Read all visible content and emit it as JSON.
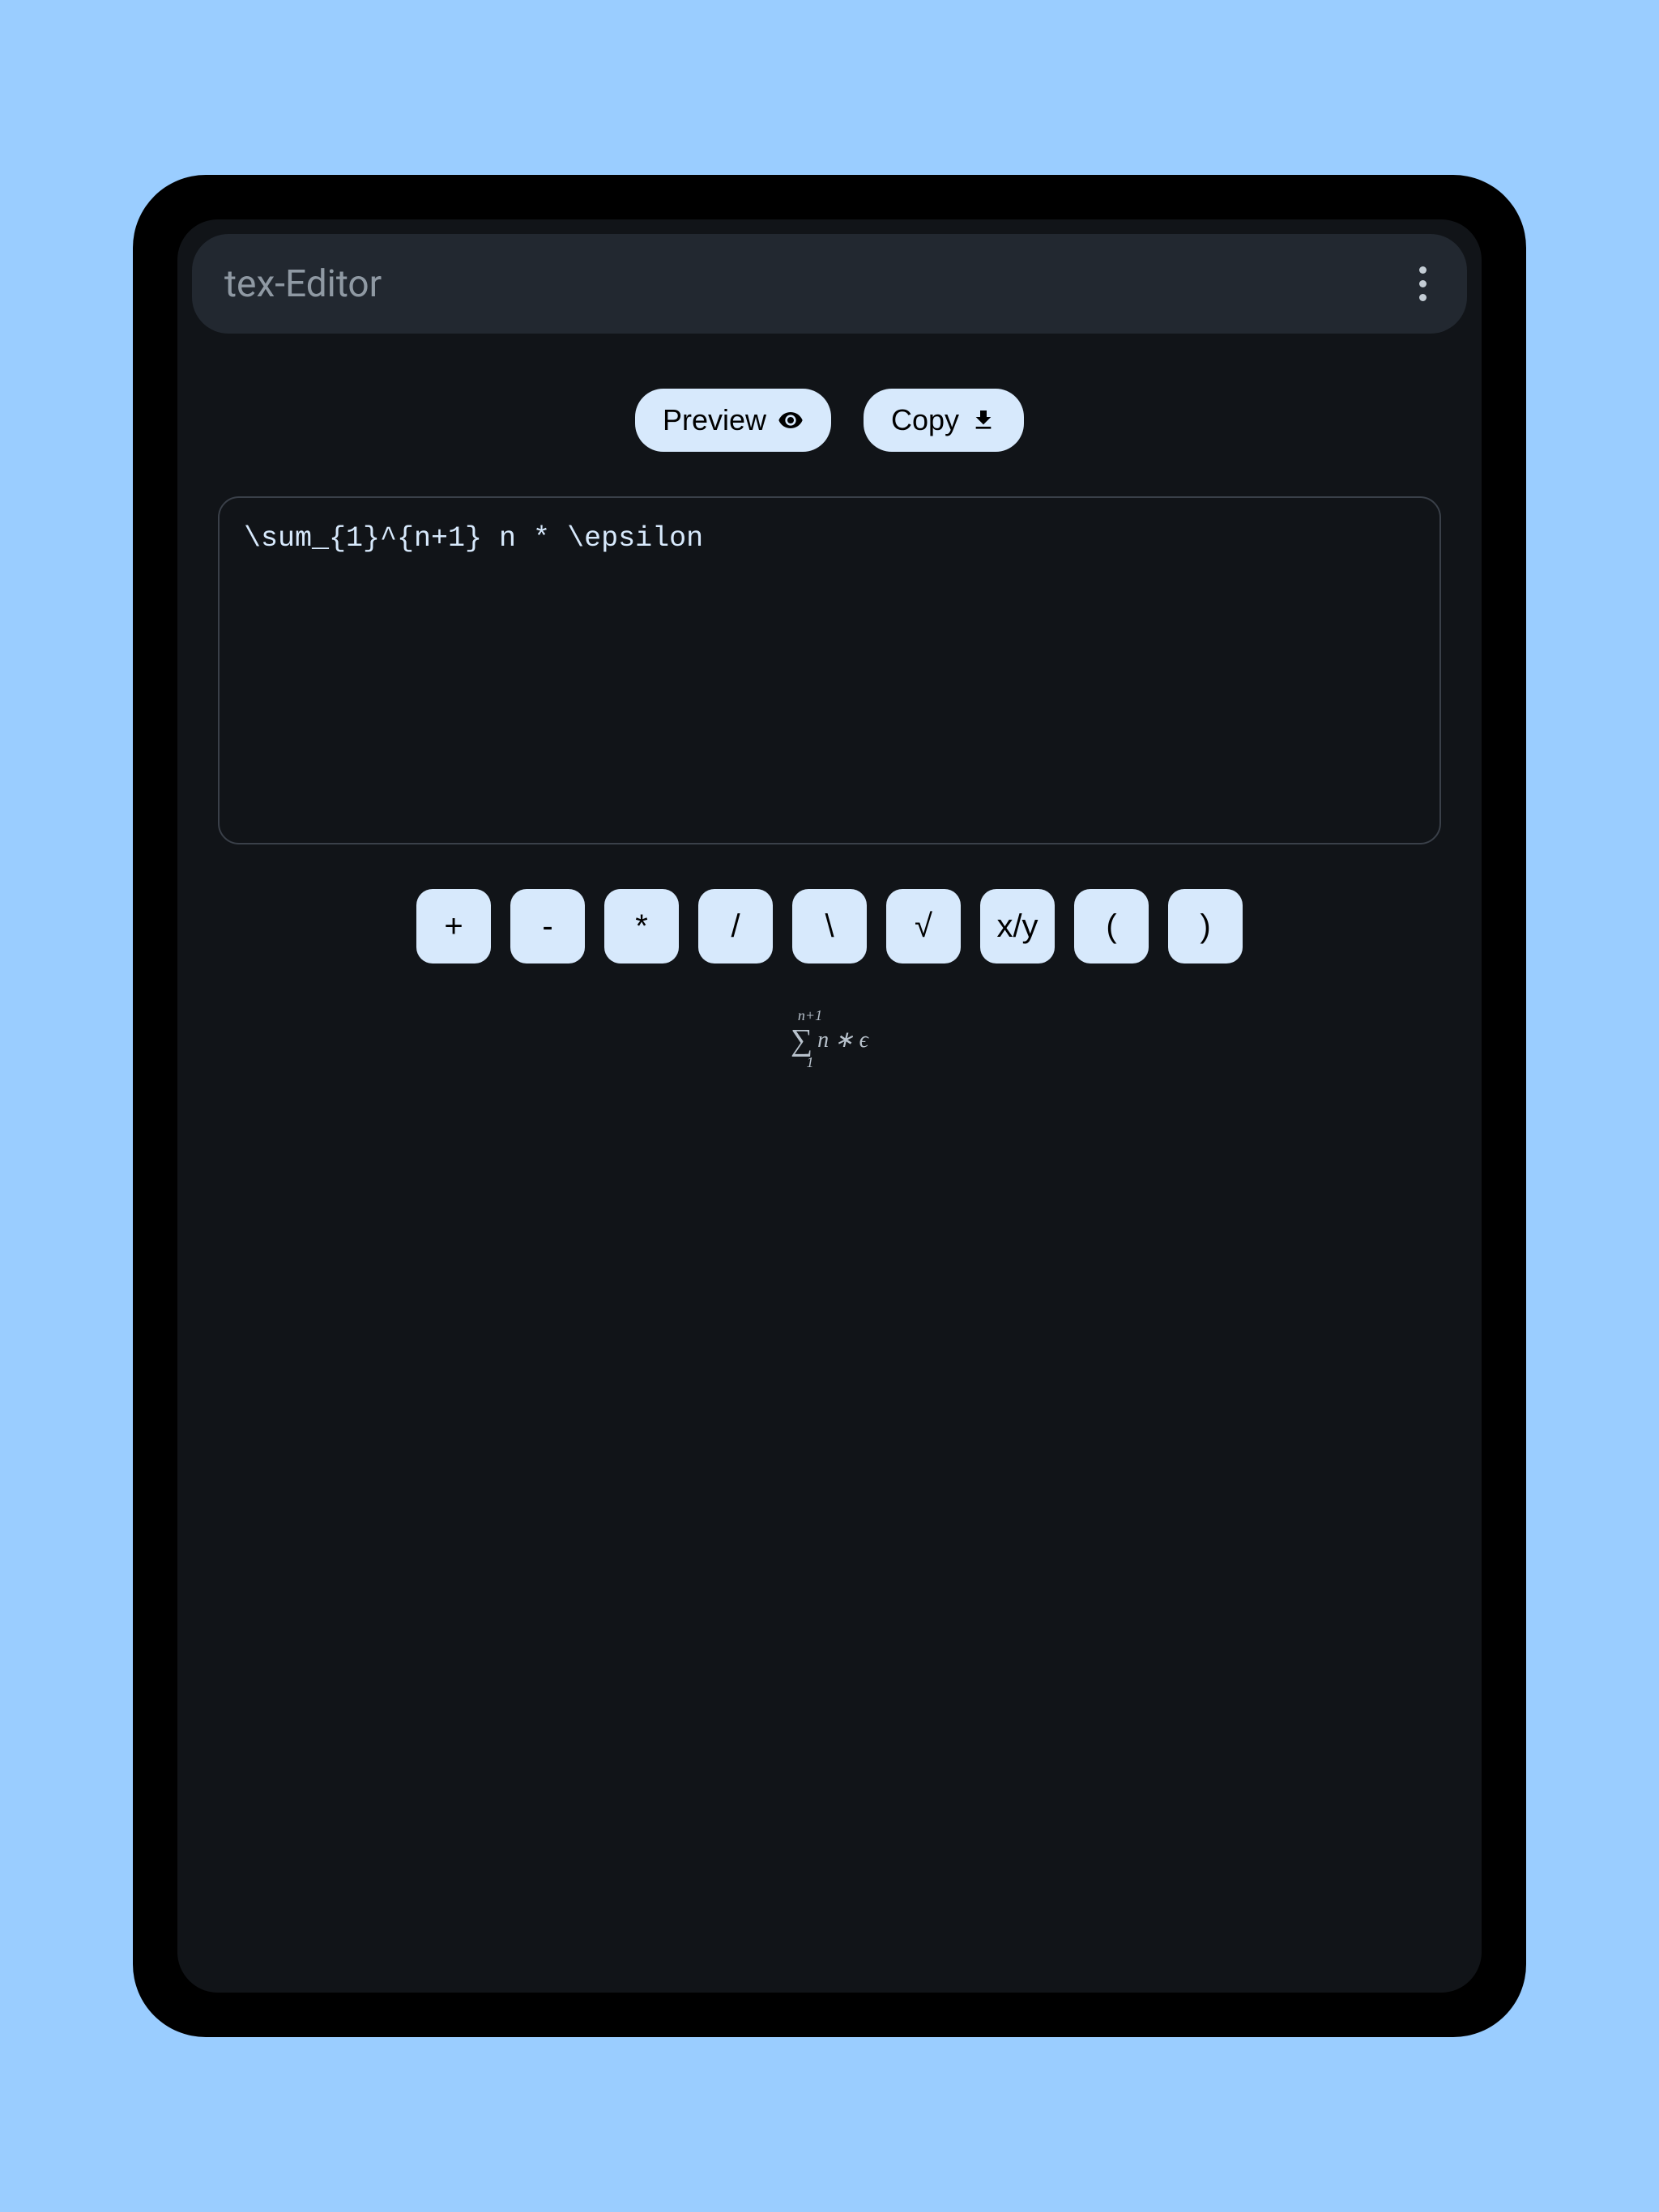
{
  "header": {
    "title": "tex-Editor"
  },
  "actions": {
    "preview_label": "Preview",
    "copy_label": "Copy"
  },
  "editor": {
    "input_value": "\\sum_{1}^{n+1} n * \\epsilon"
  },
  "symbols": {
    "items": [
      "+",
      "-",
      "*",
      "/",
      "\\",
      "√",
      "x/y",
      "(",
      ")"
    ]
  },
  "preview_render": {
    "upper": "n+1",
    "sigma": "∑",
    "body": "n ∗ ϵ",
    "lower": "1"
  }
}
